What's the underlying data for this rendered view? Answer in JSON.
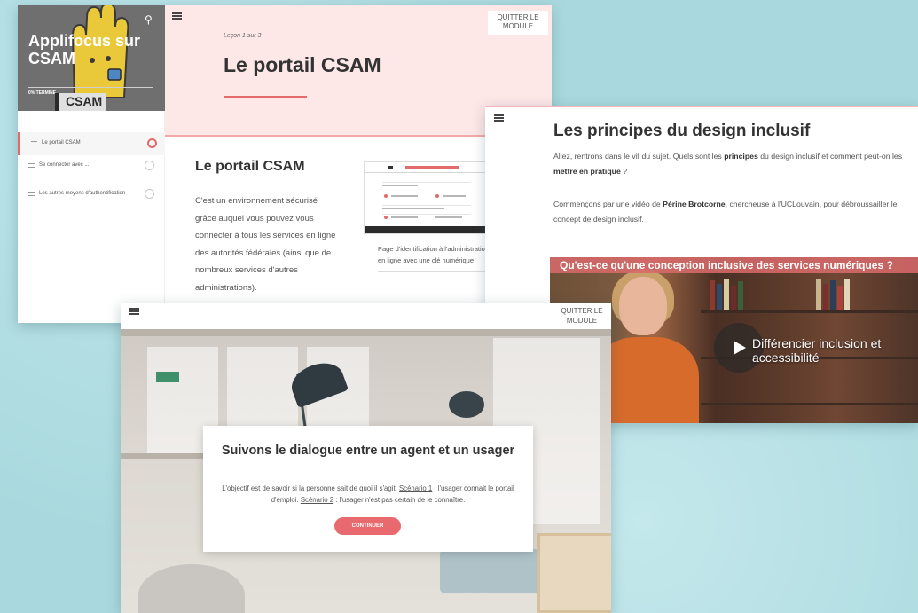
{
  "course": {
    "app_title": "Applifocus sur CSAM",
    "progress": "0% TERMINÉ",
    "logo_text": "CSAM",
    "sidebar_items": [
      {
        "label": "Le portail CSAM",
        "active": true
      },
      {
        "label": "Se connecter avec ...",
        "active": false
      },
      {
        "label": "Les autres moyens d'authentification",
        "active": false
      }
    ],
    "lesson_counter": "Leçon 1 sur 3",
    "lesson_title": "Le portail CSAM",
    "quit_label": "QUITTER LE MODULE",
    "section_title": "Le portail CSAM",
    "section_body": "C'est un environnement sécurisé grâce auquel vous pouvez vous connecter à tous les services en ligne des autorités fédérales (ainsi que de nombreux services d'autres administrations).",
    "image_caption": "Page d'identification à l'administration en ligne avec une clé numérique"
  },
  "inclusive": {
    "title": "Les principes du design inclusif",
    "p1_a": "Allez, rentrons dans le vif du sujet. Quels sont les ",
    "p1_b": "principes",
    "p1_c": " du design inclusif et comment peut-on les ",
    "p1_d": "mettre en pratique",
    "p1_e": " ?",
    "p2_a": "Commençons par une vidéo de ",
    "p2_b": "Périne Brotcorne",
    "p2_c": ", chercheuse à l'UCLouvain, pour débroussailler le concept de design inclusif.",
    "video_banner": "Qu'est-ce qu'une conception inclusive des services numériques ?",
    "video_caption": "Différencier inclusion et accessibilité"
  },
  "dialogue": {
    "quit_label": "QUITTER LE MODULE",
    "title": "Suivons le dialogue entre un agent et un usager",
    "body_a": "L'objectif est de savoir si la personne sait de quoi il s'agit. ",
    "scenario1": "Scénario 1",
    "body_b": " :  l'usager connait le portail d'emploi. ",
    "scenario2": "Scénario 2",
    "body_c": " : l'usager n'est pas certain de le connaître.",
    "button": "CONTINUER"
  },
  "colors": {
    "accent": "#e26b6b",
    "background": "#a9d9de",
    "lesson_header": "#fde7e7"
  }
}
